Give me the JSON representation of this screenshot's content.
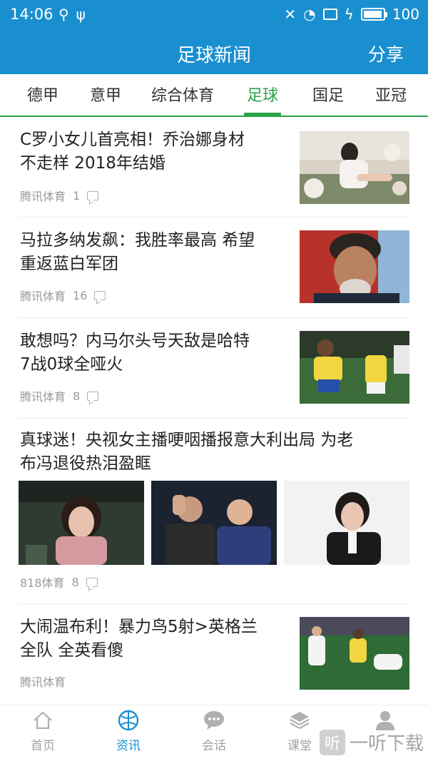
{
  "status_bar": {
    "time": "14:06",
    "battery_level": "100",
    "battery_fraction": 0.95
  },
  "header": {
    "title": "足球新闻",
    "share_label": "分享"
  },
  "tabs": [
    {
      "label": "德甲"
    },
    {
      "label": "意甲"
    },
    {
      "label": "综合体育"
    },
    {
      "label": "足球",
      "active": true
    },
    {
      "label": "国足"
    },
    {
      "label": "亚冠"
    }
  ],
  "news": [
    {
      "line1": "C罗小女儿首亮相！乔治娜身材",
      "line2": "不走样 2018年结婚",
      "source": "腾讯体育",
      "comments": "1"
    },
    {
      "line1": "马拉多纳发飙：我胜率最高 希望",
      "line2": "重返蓝白军团",
      "source": "腾讯体育",
      "comments": "16"
    },
    {
      "line1": "敢想吗？内马尔头号天敌是哈特",
      "line2": "7战0球全哑火",
      "source": "腾讯体育",
      "comments": "8"
    },
    {
      "line1": "真球迷！央视女主播哽咽播报意大利出局 为老",
      "line2": "布冯退役热泪盈眶",
      "source": "818体育",
      "comments": "8"
    },
    {
      "line1": "大闹温布利！暴力鸟5射>英格兰",
      "line2": "全队 全英看傻",
      "source": "腾讯体育"
    }
  ],
  "bottom_nav": [
    {
      "label": "首页",
      "icon": "home-icon"
    },
    {
      "label": "资讯",
      "icon": "ball-icon",
      "active": true
    },
    {
      "label": "会话",
      "icon": "chat-icon"
    },
    {
      "label": "课堂",
      "icon": "classroom-icon"
    },
    {
      "label": "",
      "icon": "profile-icon"
    }
  ],
  "watermark": {
    "logo_char": "听",
    "text": "一听下载"
  },
  "colors": {
    "primary": "#1a8fd0",
    "accent": "#2aa24a"
  }
}
